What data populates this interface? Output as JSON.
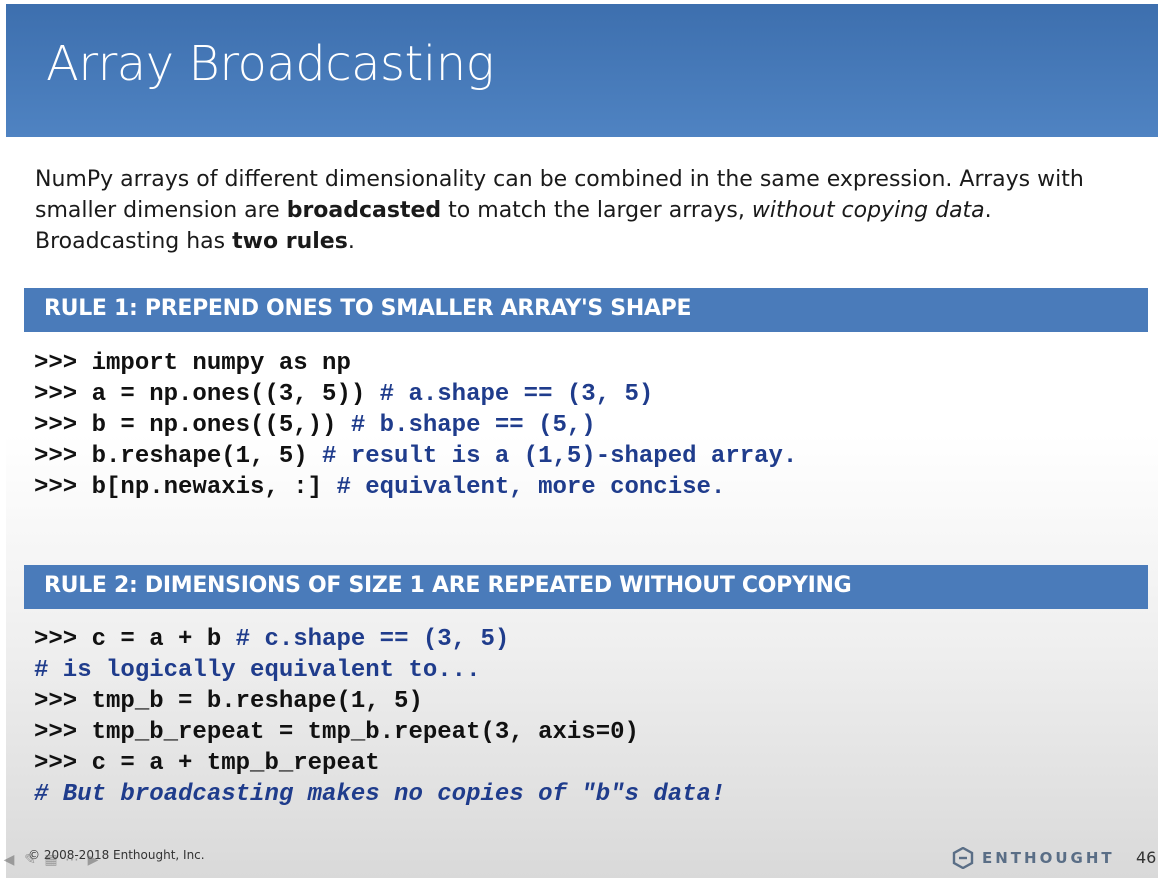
{
  "slide": {
    "title": "Array Broadcasting",
    "intro": {
      "p1": "NumPy arrays of different dimensionality can be combined in the same expression.  Arrays with smaller dimension are ",
      "b1": "broadcasted",
      "p2": " to match the larger arrays, ",
      "i1": "without copying data",
      "p3": ".  Broadcasting has ",
      "b2": "two rules",
      "p4": "."
    },
    "rule1": {
      "heading": "RULE 1: PREPEND ONES TO SMALLER ARRAY'S SHAPE",
      "code": [
        {
          "code": ">>> import numpy as np",
          "comment": ""
        },
        {
          "code": ">>> a = np.ones((3, 5)) ",
          "comment": "# a.shape == (3, 5)"
        },
        {
          "code": ">>> b = np.ones((5,)) ",
          "comment": "# b.shape == (5,)"
        },
        {
          "code": ">>> b.reshape(1, 5) ",
          "comment": "# result is a (1,5)-shaped array."
        },
        {
          "code": ">>> b[np.newaxis, :] ",
          "comment": "# equivalent, more concise."
        }
      ]
    },
    "rule2": {
      "heading": "RULE 2: DIMENSIONS OF SIZE 1 ARE REPEATED WITHOUT COPYING",
      "code": [
        {
          "code": ">>> c = a + b ",
          "comment": "# c.shape == (3, 5)"
        },
        {
          "code": "",
          "comment": "# is logically equivalent to..."
        },
        {
          "code": ">>> tmp_b = b.reshape(1, 5)",
          "comment": ""
        },
        {
          "code": ">>> tmp_b_repeat = tmp_b.repeat(3, axis=0)",
          "comment": ""
        },
        {
          "code": ">>> c = a + tmp_b_repeat",
          "comment": ""
        },
        {
          "code": "",
          "comment": "# But broadcasting makes no copies of \"b\"s data!",
          "italic": true
        }
      ]
    },
    "footer": {
      "copyright": "© 2008-2018 Enthought, Inc.",
      "logo_text": "ENTHOUGHT",
      "page_number": "46"
    },
    "nav_icons": [
      "arrow-left-icon",
      "pen-icon",
      "grid-icon",
      "more-icon",
      "arrow-right-icon"
    ],
    "colors": {
      "title_bar": "#4a7bba",
      "rule_bar": "#4a7bba",
      "comment": "#1f3c8c"
    }
  }
}
